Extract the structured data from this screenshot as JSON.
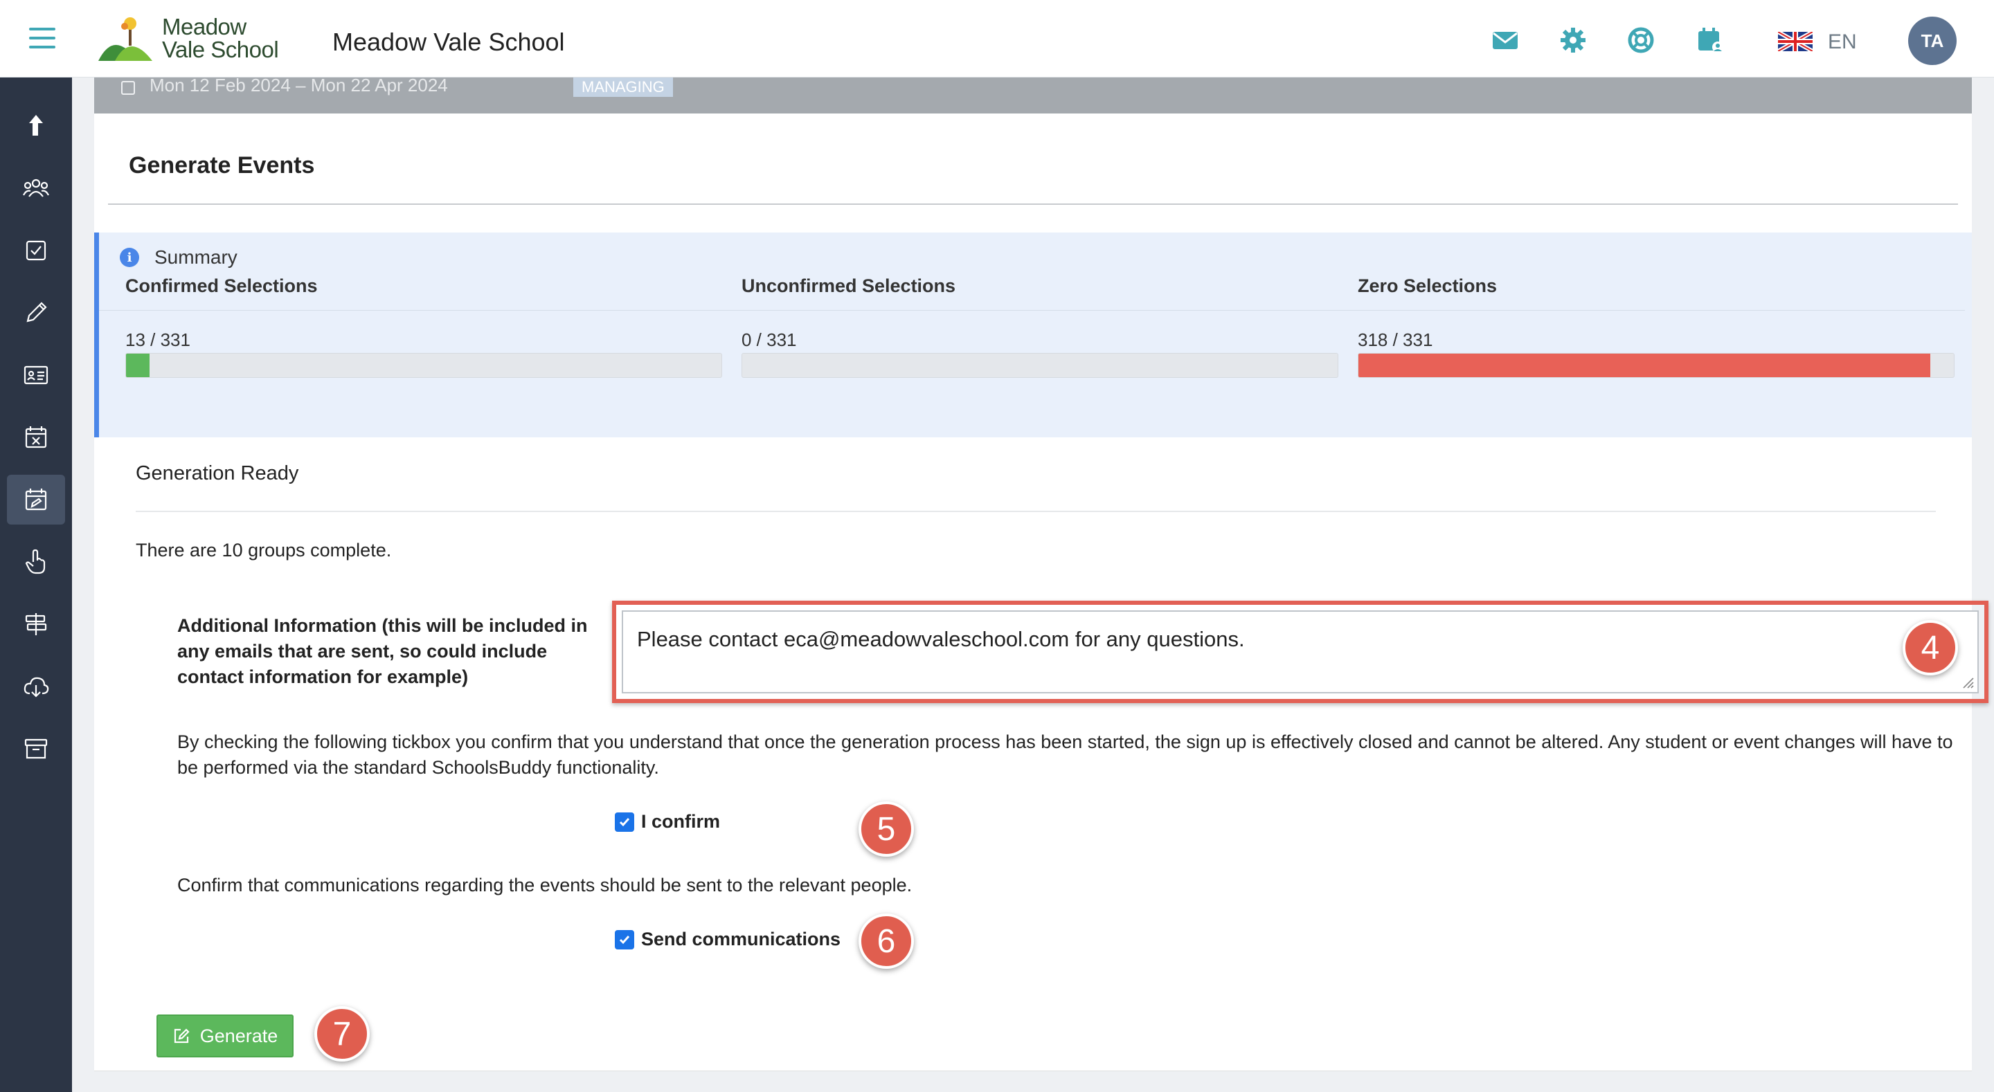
{
  "app": {
    "logo_text": "Meadow\nVale School",
    "school_name": "Meadow Vale School",
    "language": "EN",
    "avatar_initials": "TA",
    "accent_color": "#3fa7b5"
  },
  "header_strip": {
    "date_range": "Mon 12 Feb 2024 – Mon 22 Apr 2024",
    "badge": "MANAGING"
  },
  "sidebar": {
    "items": [
      {
        "icon": "share-arrow-icon"
      },
      {
        "icon": "people-icon"
      },
      {
        "icon": "checkbox-icon"
      },
      {
        "icon": "pencil-icon"
      },
      {
        "icon": "id-card-icon"
      },
      {
        "icon": "calendar-x-icon"
      },
      {
        "icon": "calendar-edit-icon",
        "active": true
      },
      {
        "icon": "hand-pointer-icon"
      },
      {
        "icon": "signpost-icon"
      },
      {
        "icon": "cloud-download-icon"
      },
      {
        "icon": "archive-icon"
      }
    ]
  },
  "main": {
    "title": "Generate Events",
    "summary": {
      "label": "Summary",
      "columns": [
        {
          "title": "Confirmed Selections",
          "count": "13 / 331",
          "fraction": 0.0393,
          "color": "#5cb85c"
        },
        {
          "title": "Unconfirmed Selections",
          "count": "0 / 331",
          "fraction": 0,
          "color": "#5bc0de"
        },
        {
          "title": "Zero Selections",
          "count": "318 / 331",
          "fraction": 0.9607,
          "color": "#e86157"
        }
      ]
    },
    "generation_ready": "Generation Ready",
    "groups_text": "There are 10 groups complete.",
    "additional_info_label": "Additional Information (this will be included in any emails that are sent, so could include contact information for example)",
    "additional_info_value": "Please contact eca@meadowvaleschool.com for any questions.",
    "disclaimer": "By checking the following tickbox you confirm that you understand that once the generation process has been started, the sign up is effectively closed and cannot be altered. Any student or event changes will have to be performed via the standard SchoolsBuddy functionality.",
    "confirm_label": "I confirm",
    "confirm_checked": true,
    "communications_text": "Confirm that communications regarding the events should be sent to the relevant people.",
    "send_comm_label": "Send communications",
    "send_comm_checked": true,
    "generate_label": "Generate"
  },
  "annotations": {
    "step4": "4",
    "step5": "5",
    "step6": "6",
    "step7": "7"
  }
}
